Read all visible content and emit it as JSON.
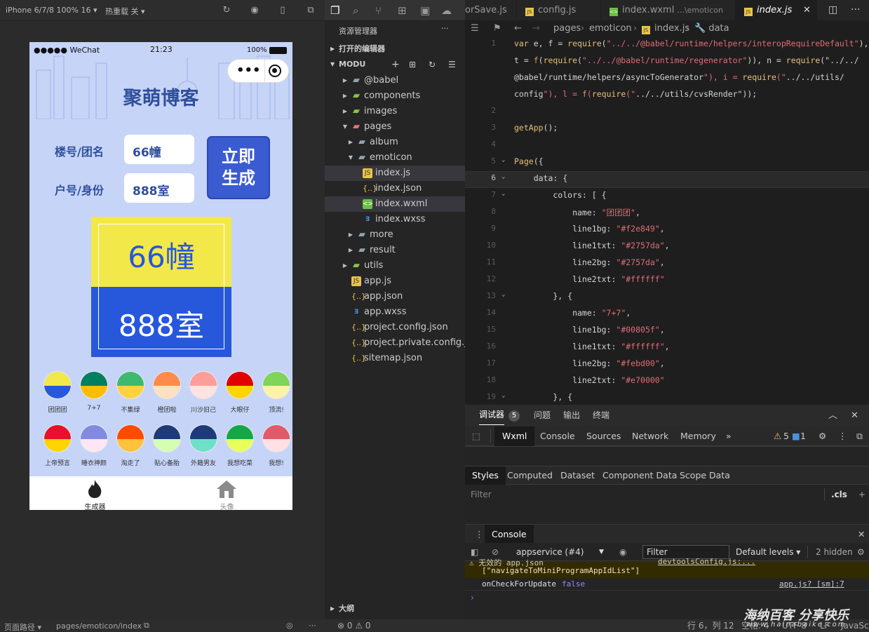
{
  "sim": {
    "device": "iPhone 6/7/8 100% 16 ▾",
    "hotreload": "热重载 关 ▾",
    "status": {
      "carrier": "●●●●● WeChat",
      "time": "21:23",
      "battery": "100%"
    },
    "app_title": "聚萌博客",
    "label1": "楼号/团名",
    "label2": "户号/身份",
    "input1": "66幢",
    "input2": "888室",
    "gen_button_line1": "立即",
    "gen_button_line2": "生成",
    "preview_top": "66幢",
    "preview_bottom": "888室",
    "swatches_row1": [
      {
        "name": "团团团",
        "c1": "#f2e849",
        "c2": "#2757da"
      },
      {
        "name": "7+7",
        "c1": "#00805f",
        "c2": "#febd00"
      },
      {
        "name": "不集绿",
        "c1": "#3dba6f",
        "c2": "#ffd23f"
      },
      {
        "name": "橙团啦",
        "c1": "#ff8a4c",
        "c2": "#ffe0c0"
      },
      {
        "name": "川沙旧己",
        "c1": "#ff9d9a",
        "c2": "#ffe3e0"
      },
      {
        "name": "大眼仔",
        "c1": "#e00000",
        "c2": "#ffd400"
      },
      {
        "name": "顶流!",
        "c1": "#7fd45a",
        "c2": "#fff2a6"
      }
    ],
    "swatches_row2": [
      {
        "name": "上帝预言",
        "c1": "#e8102a",
        "c2": "#ffd400"
      },
      {
        "name": "睡衣神颜",
        "c1": "#7f8ae0",
        "c2": "#ffe6f2"
      },
      {
        "name": "淘走了",
        "c1": "#ff4a00",
        "c2": "#ffc23d"
      },
      {
        "name": "贴心备胎",
        "c1": "#1e3a78",
        "c2": "#d4ffb0"
      },
      {
        "name": "外籍男友",
        "c1": "#1e3a78",
        "c2": "#6fe0c8"
      },
      {
        "name": "我想吃菜",
        "c1": "#12a84a",
        "c2": "#e8ff5a"
      },
      {
        "name": "我想!",
        "c1": "#e05a6a",
        "c2": "#ffe0e4"
      }
    ],
    "tab_generator": "生成器",
    "tab_avatar": "头像",
    "footer_path_label": "页面路径 ▾",
    "footer_path": "pages/emoticon/index"
  },
  "explorer": {
    "title": "资源管理器",
    "open_editors": "打开的编辑器",
    "root": "MODU",
    "outline": "大纲",
    "items": [
      {
        "name": "@babel",
        "level": 1,
        "type": "folder",
        "open": false
      },
      {
        "name": "components",
        "level": 1,
        "type": "folder-green",
        "open": false
      },
      {
        "name": "images",
        "level": 1,
        "type": "folder-green",
        "open": false
      },
      {
        "name": "pages",
        "level": 1,
        "type": "folder-red",
        "open": true
      },
      {
        "name": "album",
        "level": 2,
        "type": "folder",
        "open": false
      },
      {
        "name": "emoticon",
        "level": 2,
        "type": "folder",
        "open": true
      },
      {
        "name": "index.js",
        "level": 3,
        "type": "js",
        "sel": true
      },
      {
        "name": "index.json",
        "level": 3,
        "type": "json"
      },
      {
        "name": "index.wxml",
        "level": 3,
        "type": "wxml",
        "sel2": true
      },
      {
        "name": "index.wxss",
        "level": 3,
        "type": "wxss"
      },
      {
        "name": "more",
        "level": 2,
        "type": "folder",
        "open": false
      },
      {
        "name": "result",
        "level": 2,
        "type": "folder",
        "open": false
      },
      {
        "name": "utils",
        "level": 1,
        "type": "folder-green",
        "open": false
      },
      {
        "name": "app.js",
        "level": 1,
        "type": "js"
      },
      {
        "name": "app.json",
        "level": 1,
        "type": "json"
      },
      {
        "name": "app.wxss",
        "level": 1,
        "type": "wxss"
      },
      {
        "name": "project.config.json",
        "level": 1,
        "type": "json"
      },
      {
        "name": "project.private.config.js...",
        "level": 1,
        "type": "json"
      },
      {
        "name": "sitemap.json",
        "level": 1,
        "type": "json"
      }
    ]
  },
  "editor": {
    "tabs": [
      "orSave.js",
      "config.js",
      "index.wxml",
      "...\\emoticon",
      "index.js"
    ],
    "breadcrumb": [
      "pages",
      "emoticon",
      "index.js",
      "data"
    ],
    "lines": [
      {
        "n": "1",
        "t": "var e, f = require(\"../../@babel/runtime/helpers/interopRequireDefault\"),"
      },
      {
        "n": "",
        "t": "t = f(require(\"../../@babel/runtime/regenerator\")), n = require(\"../../"
      },
      {
        "n": "",
        "t": "@babel/runtime/helpers/asyncToGenerator\"), i = require(\"../../utils/"
      },
      {
        "n": "",
        "t": "config\"), l = f(require(\"../../utils/cvsRender\"));"
      },
      {
        "n": "2",
        "t": ""
      },
      {
        "n": "3",
        "t": "getApp();"
      },
      {
        "n": "4",
        "t": ""
      },
      {
        "n": "5",
        "t": "Page({"
      },
      {
        "n": "6",
        "t": "    data: {"
      },
      {
        "n": "7",
        "t": "        colors: [ {"
      },
      {
        "n": "8",
        "t": "            name: \"团团团\","
      },
      {
        "n": "9",
        "t": "            line1bg: \"#f2e849\","
      },
      {
        "n": "10",
        "t": "            line1txt: \"#2757da\","
      },
      {
        "n": "11",
        "t": "            line2bg: \"#2757da\","
      },
      {
        "n": "12",
        "t": "            line2txt: \"#ffffff\""
      },
      {
        "n": "13",
        "t": "        }, {"
      },
      {
        "n": "14",
        "t": "            name: \"7+7\","
      },
      {
        "n": "15",
        "t": "            line1bg: \"#00805f\","
      },
      {
        "n": "16",
        "t": "            line1txt: \"#ffffff\","
      },
      {
        "n": "17",
        "t": "            line2bg: \"#febd00\","
      },
      {
        "n": "18",
        "t": "            line2txt: \"#e70000\""
      },
      {
        "n": "19",
        "t": "        }, {"
      }
    ]
  },
  "devtools": {
    "tab_debugger": "调试器",
    "badge": "5",
    "tab_issues": "问题",
    "tab_output": "输出",
    "tab_terminal": "终端",
    "panels": [
      "Wxml",
      "Console",
      "Sources",
      "Network",
      "Memory"
    ],
    "warn_count": "5",
    "info_count": "1",
    "style_tabs": [
      "Styles",
      "Computed",
      "Dataset",
      "Component Data",
      "Scope Data"
    ],
    "filter_placeholder": "Filter",
    "cls": ".cls",
    "console_title": "Console",
    "context": "appservice (#4)",
    "console_filter": "Filter",
    "levels": "Default levels ▾",
    "hidden": "2 hidden",
    "warn_line1": "⚠ 无效的 app.json",
    "warn_link": "devtoolsConfig.js:...",
    "warn_line2": "[\"navigateToMiniProgramAppIdList\"]",
    "log_text": "onCheckForUpdate",
    "log_value": "false",
    "log_link": "app.js? [sm]:7"
  },
  "statusbar": {
    "errors": "⊗ 0 ⚠ 0",
    "cursor": "行 6，列 12",
    "spaces": "空格: 4",
    "enc": "UTF-8",
    "eol": "LF",
    "lang": "JavaScript"
  },
  "watermark": {
    "line1": "海纳百客 分享快乐",
    "line2": "www.hainabaike.com"
  }
}
